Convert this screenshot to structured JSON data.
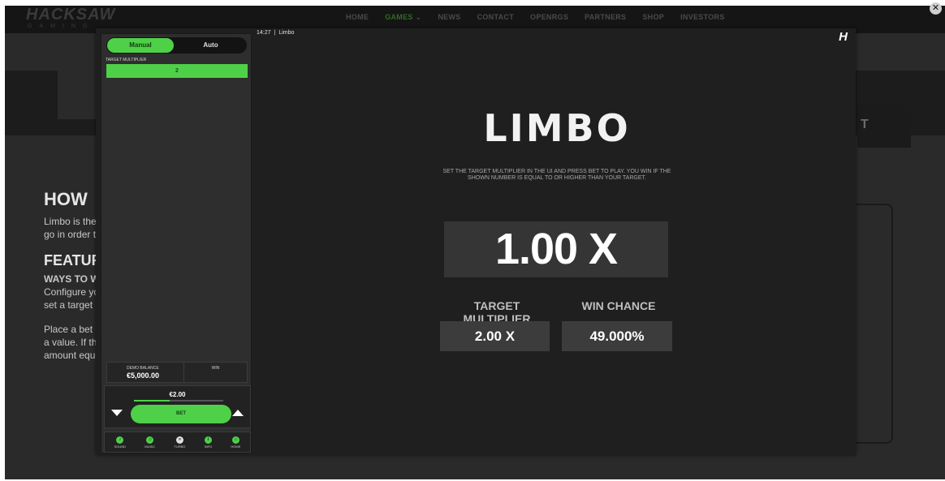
{
  "site": {
    "logo": "HACKSAW",
    "logo_sub": "GAMING",
    "nav": [
      "HOME",
      "GAMES",
      "NEWS",
      "CONTACT",
      "OPENRGS",
      "PARTNERS",
      "SHOP",
      "INVESTORS"
    ],
    "active_nav": "GAMES",
    "close_icon": "close-circle-icon",
    "hero_right_text": "T",
    "text": {
      "how_heading": "HOW",
      "how_line1": "Limbo is the",
      "how_line2": "go in order t",
      "features_heading": "FEATUR",
      "ways_heading": "WAYS TO WI",
      "ways_line1": "Configure yo",
      "ways_line2": "set a target",
      "place_line1": "Place a bet",
      "place_line2": "a value. If th",
      "place_line3": "amount equ"
    }
  },
  "game": {
    "time": "14:27",
    "separator": "|",
    "name": "Limbo",
    "logo": "H",
    "title": "LIMBO",
    "instructions": "SET THE TARGET MULTIPLIER IN THE UI AND PRESS BET TO PLAY. YOU WIN IF THE SHOWN NUMBER IS EQUAL TO OR HIGHER THAN YOUR TARGET.",
    "multiplier": "1.00 X",
    "target_multiplier_label": "TARGET MULTIPLIER",
    "target_multiplier_value": "2.00 X",
    "win_chance_label": "WIN CHANCE",
    "win_chance_value": "49.000%"
  },
  "panel": {
    "mode_manual": "Manual",
    "mode_auto": "Auto",
    "target_label": "TARGET MULTIPLIER",
    "target_value": "2",
    "balance_label": "DEMO BALANCE",
    "balance_value": "€5,000.00",
    "win_label": "WIN",
    "bet_amount": "€2.00",
    "bet_slider_fraction": 0.4,
    "bet_button": "BET",
    "toolbar": [
      {
        "label": "SOUND",
        "icon": "sound-icon"
      },
      {
        "label": "MUSIC",
        "icon": "music-icon"
      },
      {
        "label": "TURBO",
        "icon": "turbo-icon"
      },
      {
        "label": "INFO",
        "icon": "info-icon"
      },
      {
        "label": "HOME",
        "icon": "home-icon"
      }
    ]
  },
  "colors": {
    "accent": "#4ed148",
    "game_bg": "#1f1f1f",
    "panel_bg": "#2e2e2e"
  }
}
